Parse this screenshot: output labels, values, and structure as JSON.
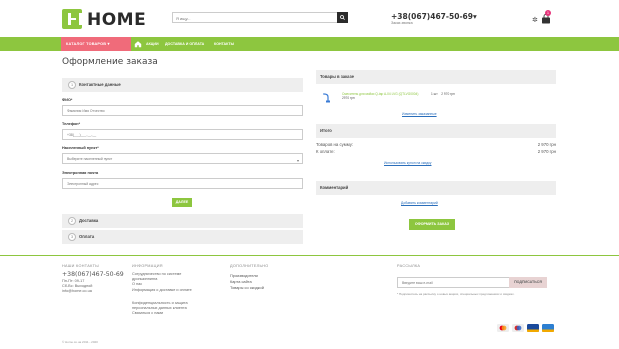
{
  "header": {
    "logo_text": "HOME",
    "search_placeholder": "Я ищу...",
    "phone": "+38(067)467-50-69",
    "phone_caret": "▾",
    "callback": "Заказ звонка",
    "cart_count": "1"
  },
  "nav": {
    "catalog": "КАТАЛОГ ТОВАРОВ ▾",
    "links": [
      "АКЦИИ",
      "ДОСТАВКА И ОПЛАТА",
      "КОНТАКТЫ"
    ]
  },
  "checkout": {
    "title": "Оформление заказа",
    "contact_section": {
      "num": "1",
      "label": "Контактные данные"
    },
    "fio_label": "ФИО*",
    "fio_placeholder": "Фамилия Имя Отчество",
    "phone_label": "Телефон*",
    "phone_placeholder": "+38(___)___-__-__",
    "point_label": "Населенный пункт*",
    "point_placeholder": "Выберите населенный пункт",
    "email_label": "Электронная почта",
    "email_placeholder": "Электронный адрес",
    "next_button": "ДАЛЕЕ",
    "delivery_section": {
      "num": "2",
      "label": "Доставка"
    },
    "payment_section": {
      "num": "3",
      "label": "Оплата"
    }
  },
  "order": {
    "items_title": "Товары в заказе",
    "item_name": "Смеситель для мойки Q-tap A-04 LVG (QTLVG0004)",
    "item_price": "2970 грн",
    "item_qty": "1 шт",
    "item_total": "2 970 грн",
    "edit_link": "Изменить заказанные",
    "total_title": "Итого",
    "sum_label": "Товаров на сумму:",
    "sum_value": "2 970 грн",
    "pay_label": "К оплате:",
    "pay_value": "2 970 грн",
    "promo_link": "Использовать купон на скидку",
    "comment_title": "Комментарий",
    "comment_link": "Добавить комментарий",
    "order_button": "ОФОРМИТЬ ЗАКАЗ"
  },
  "footer": {
    "contacts_head": "НАШИ КОНТАКТЫ",
    "phone": "+38(067)467-50-69",
    "hours": "Пн-Пт: 09-17",
    "days_off": "Сб-Вс: Выходной",
    "email": "info@home.co.ua",
    "info_head": "ИНФОРМАЦИЯ",
    "info_items": [
      "Сотрудничество по системе дропшиппинга",
      "О нас",
      "Информация о доставке и оплате",
      "Конфиденциальность и защита персональных данных клиента",
      "Связаться с нами"
    ],
    "extra_head": "ДОПОЛНИТЕЛЬНО",
    "extra_items": [
      "Производители",
      "Карта сайта",
      "Товары со скидкой"
    ],
    "news_head": "РАССЫЛКА",
    "news_placeholder": "Введите ваш e-mail",
    "news_button": "ПОДПИСАТЬСЯ",
    "news_note": "* Подпишитесь на рассылку о новых акциях, специальных предложениях и скидках.",
    "copyright": "© Home.co.ua 2011 - 2020"
  },
  "colors": {
    "accent_green": "#8dc63f",
    "catalog_pink": "#f06b7a",
    "badge_pink": "#e6337a"
  }
}
